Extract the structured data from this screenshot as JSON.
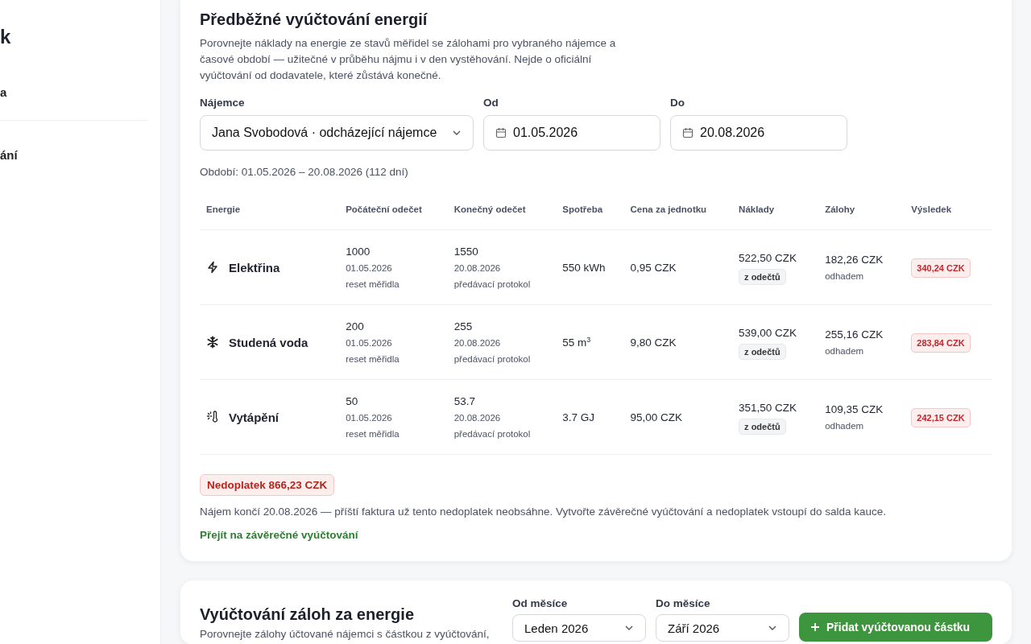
{
  "sidebar": {
    "items": [
      {
        "kind": "brand",
        "label": "k"
      },
      {
        "kind": "item",
        "label": "a"
      },
      {
        "kind": "item",
        "label": "ání"
      }
    ]
  },
  "estimate": {
    "title": "Předběžné vyúčtování energií",
    "description": "Porovnejte náklady na energie ze stavů měřidel se zálohami pro vybraného nájemce a časové období — užitečné v průběhu nájmu i v den vystěhování. Nejde o oficiální vyúčtování od dodavatele, které zůstává konečné.",
    "fields": [
      {
        "kind": "select",
        "label": "Nájemce",
        "value": "Jana Svobodová · odcházející nájemce"
      },
      {
        "kind": "date",
        "label": "Od",
        "value": "01.05.2026"
      },
      {
        "kind": "date",
        "label": "Do",
        "value": "20.08.2026"
      }
    ],
    "period": "Období: 01.05.2026 – 20.08.2026 (112 dní)",
    "table": {
      "columns": [
        "Energie",
        "Počáteční odečet",
        "Konečný odečet",
        "Spotřeba",
        "Cena za jednotku",
        "Náklady",
        "Zálohy",
        "Výsledek"
      ],
      "rows": [
        {
          "kind": "electricity",
          "energy": "Elektřina",
          "start": "1000",
          "start_date": "01.05.2026",
          "start_note": "reset měřidla",
          "end": "1550",
          "end_date": "20.08.2026",
          "end_note": "předávací protokol",
          "usage": "550 kWh",
          "price": "0,95 CZK",
          "cost": "522,50 CZK",
          "cost_source": "z odečtů",
          "advance": "182,26 CZK",
          "advance_note": "odhadem",
          "result": "340,24 CZK"
        },
        {
          "kind": "water",
          "energy": "Studená voda",
          "start": "200",
          "start_date": "01.05.2026",
          "start_note": "reset měřidla",
          "end": "255",
          "end_date": "20.08.2026",
          "end_note": "předávací protokol",
          "usage": "55 m$^{3}$",
          "price": "9,80 CZK",
          "cost": "539,00 CZK",
          "cost_source": "z odečtů",
          "advance": "255,16 CZK",
          "advance_note": "odhadem",
          "result": "283,84 CZK"
        },
        {
          "kind": "heating",
          "energy": "Vytápění",
          "start": "50",
          "start_date": "01.05.2026",
          "start_note": "reset měřidla",
          "end": "53.7",
          "end_date": "20.08.2026",
          "end_note": "předávací protokol",
          "usage": "3.7 GJ",
          "price": "95,00 CZK",
          "cost": "351,50 CZK",
          "cost_source": "z odečtů",
          "advance": "109,35 CZK",
          "advance_note": "odhadem",
          "result": "242,15 CZK"
        }
      ]
    },
    "total": "Nedoplatek 866,23 CZK",
    "note": "Nájem končí 20.08.2026 — příští faktura už tento nedoplatek neobsáhne. Vytvořte závěrečné vyúčtování a nedoplatek vstoupí do salda kauce.",
    "link": "Přejít na závěrečné vyúčtování"
  },
  "advances": {
    "title": "Vyúčtování záloh za energie",
    "description": "Porovnejte zálohy účtované nájemci s částkou z vyúčtování,",
    "fields": [
      {
        "label": "Od měsíce",
        "value": "Leden 2026"
      },
      {
        "label": "Do měsíce",
        "value": "Září 2026"
      }
    ],
    "button": "Přidat vyúčtovanou částku"
  }
}
